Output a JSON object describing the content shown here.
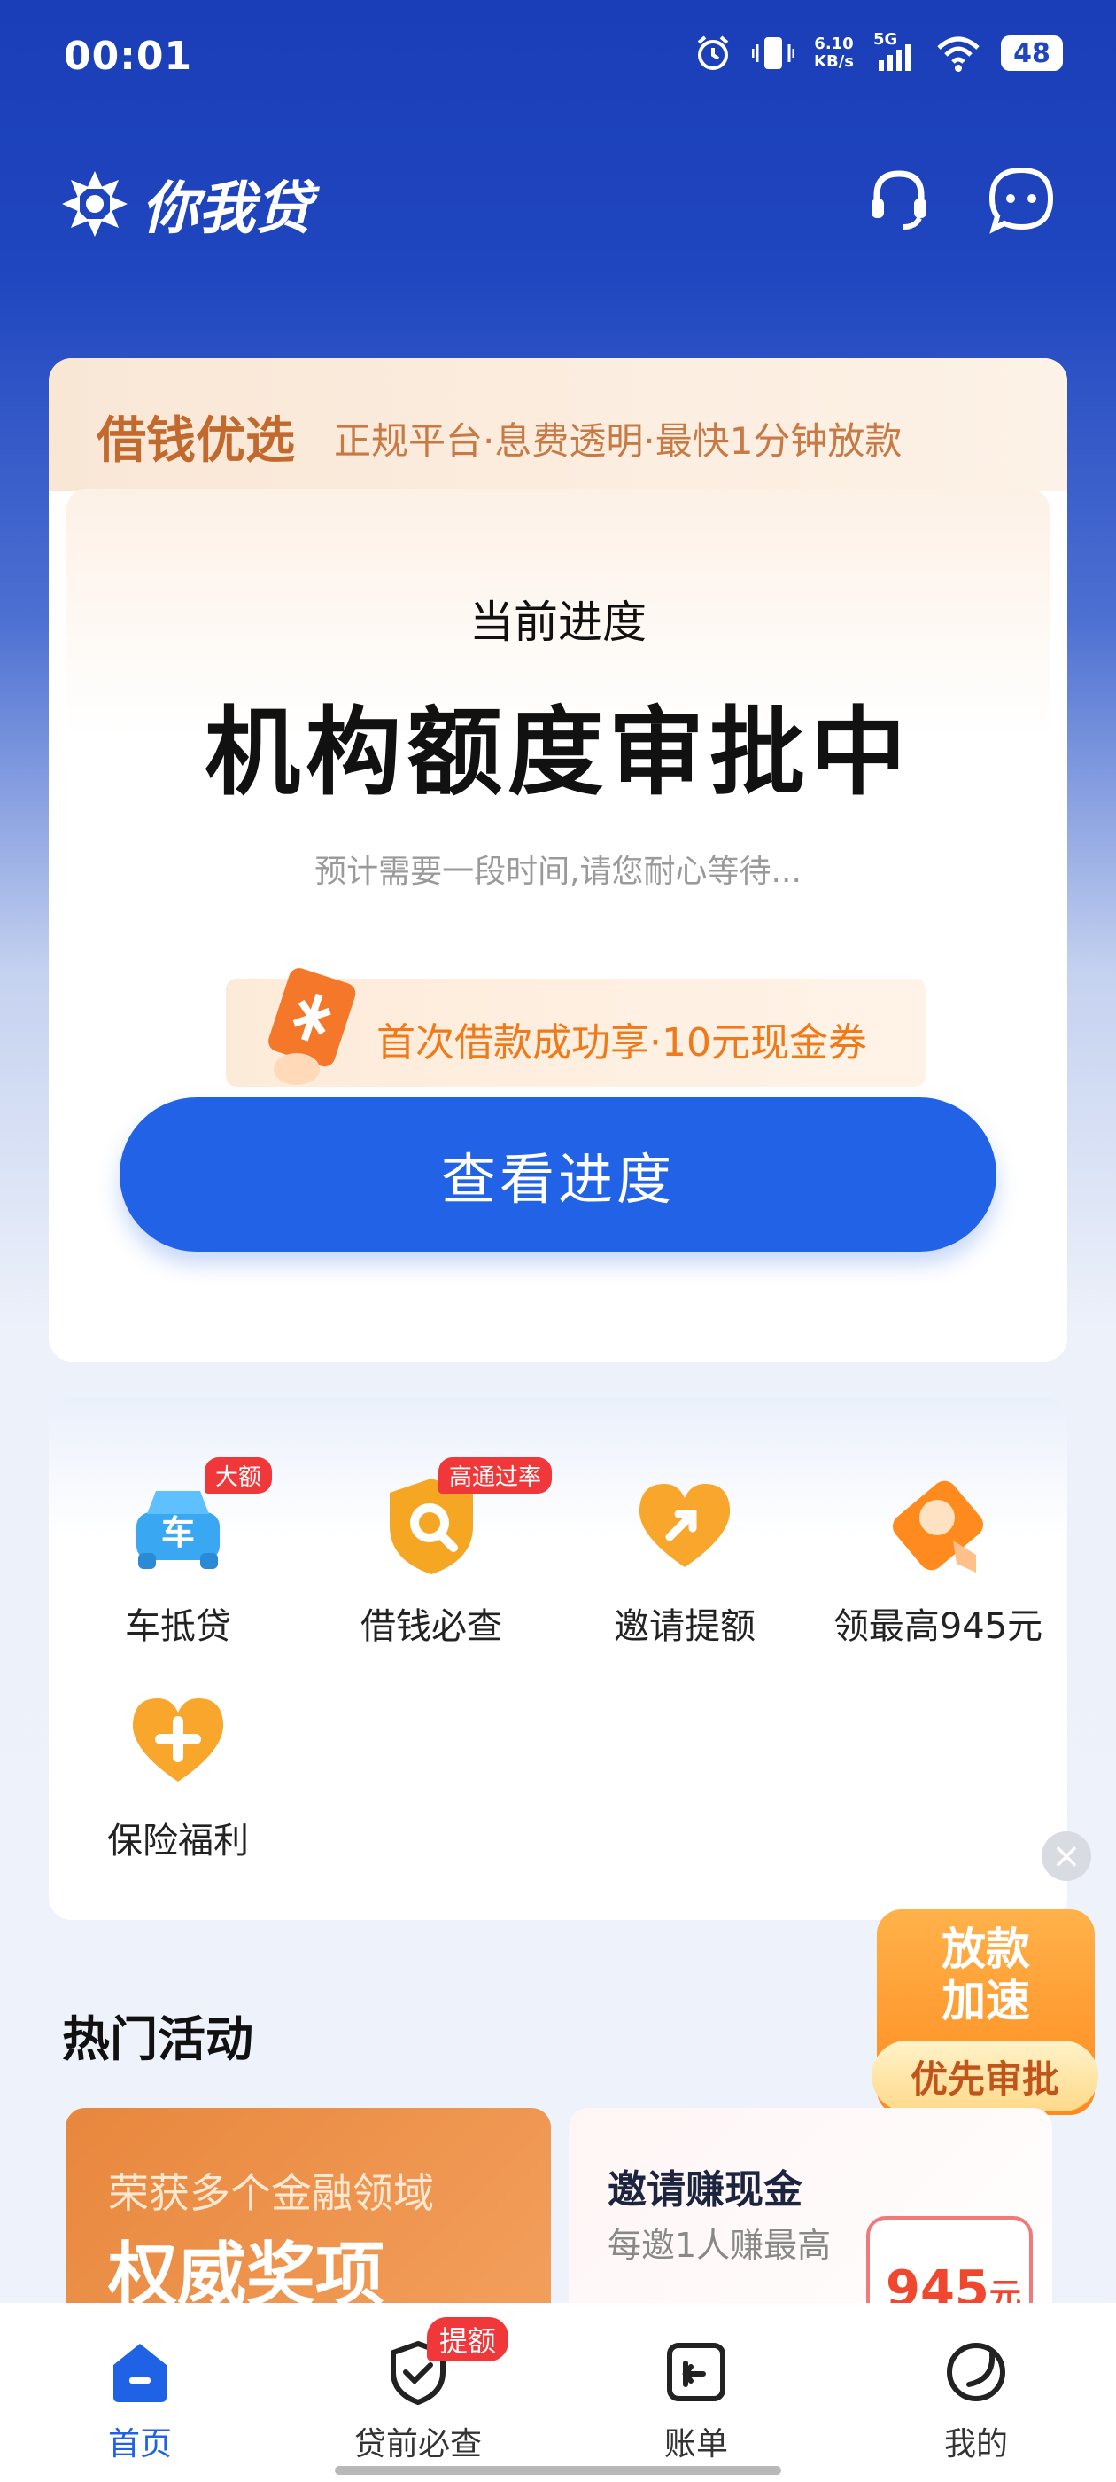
{
  "status_bar": {
    "time": "00:01",
    "net_speed_value": "6.10",
    "net_speed_unit": "KB/s",
    "network": "5G",
    "battery": "48"
  },
  "header": {
    "brand": "你我贷"
  },
  "loan_card": {
    "title": "借钱优选",
    "subtitle": "正规平台·息费透明·最快1分钟放款",
    "progress_label": "当前进度",
    "progress_status": "机构额度审批中",
    "progress_hint": "预计需要一段时间,请您耐心等待...",
    "coupon_text": "首次借款成功享·10元现金券",
    "cta": "查看进度"
  },
  "services": [
    {
      "label": "车抵贷",
      "badge": "大额",
      "icon": "car-icon"
    },
    {
      "label": "借钱必查",
      "badge": "高通过率",
      "icon": "search-shield-icon"
    },
    {
      "label": "邀请提额",
      "badge": "",
      "icon": "heart-arrow-icon"
    },
    {
      "label": "领最高945元",
      "badge": "",
      "icon": "red-packet-icon"
    },
    {
      "label": "保险福利",
      "badge": "",
      "icon": "heart-plus-icon"
    }
  ],
  "float_promo": {
    "title_line1": "放款",
    "title_line2": "加速",
    "button": "优先审批"
  },
  "hot": {
    "title": "热门活动",
    "card1_sub": "荣获多个金融领域",
    "card1_main": "权威奖项",
    "card2_title": "邀请赚现金",
    "card2_sub": "每邀1人赚最高",
    "card2_amount": "945",
    "card2_unit": "元"
  },
  "tabbar": {
    "items": [
      {
        "label": "首页",
        "active": true
      },
      {
        "label": "贷前必查",
        "badge": "提额"
      },
      {
        "label": "账单"
      },
      {
        "label": "我的"
      }
    ]
  },
  "colors": {
    "brand_blue": "#1f45bf",
    "cta_blue": "#2162e6",
    "accent_orange": "#ff8a1e",
    "badge_red": "#f0373a"
  }
}
